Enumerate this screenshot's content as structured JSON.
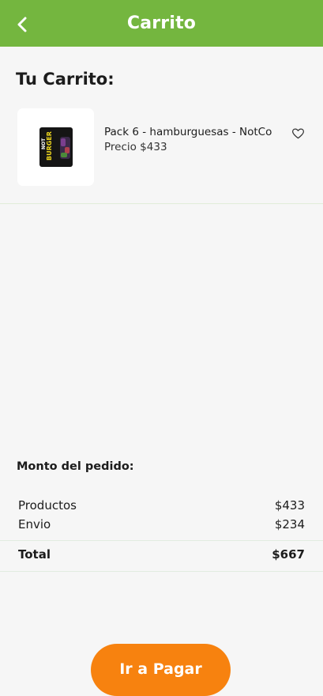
{
  "header": {
    "title": "Carrito",
    "back_icon": "chevron-left-icon",
    "color": "#74b63f"
  },
  "cart": {
    "heading": "Tu Carrito:",
    "items": [
      {
        "name": "Pack 6 - hamburguesas - NotCo",
        "price": "Precio $433",
        "image_text_1": "NOT",
        "image_text_2": "BURGER",
        "favorite_icon": "heart-outline-icon"
      }
    ]
  },
  "summary": {
    "heading": "Monto del pedido:",
    "products_label": "Productos",
    "products_value": "$433",
    "shipping_label": "Envio",
    "shipping_value": "$234",
    "total_label": "Total",
    "total_value": "$667"
  },
  "actions": {
    "pay_label": "Ir a Pagar",
    "pay_color": "#f7820f"
  }
}
